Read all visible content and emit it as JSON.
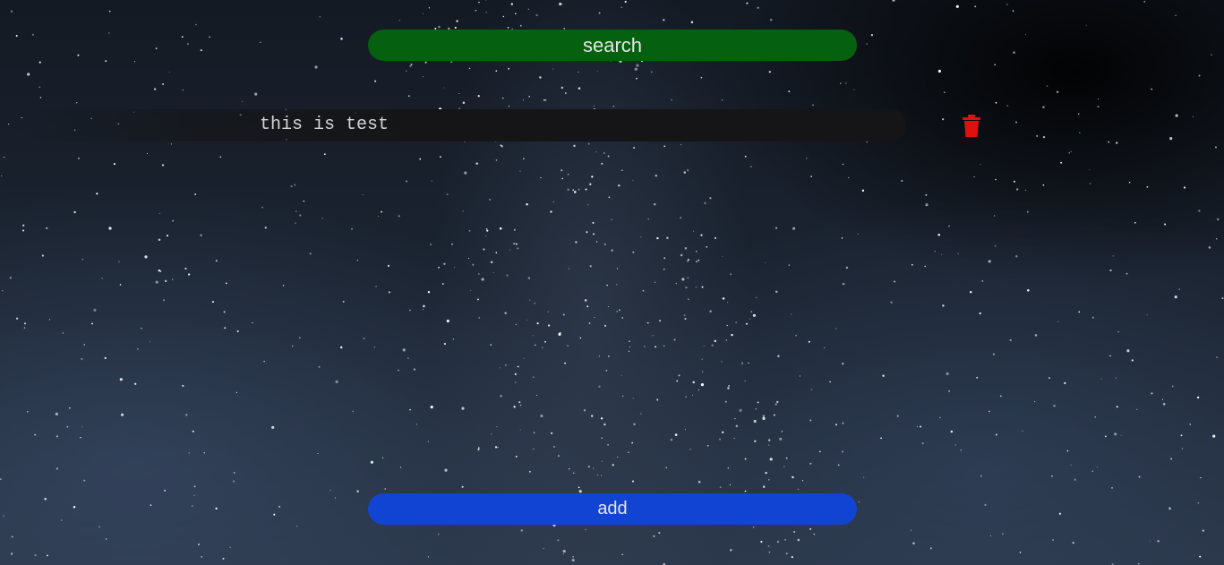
{
  "toolbar": {
    "search_label": "search"
  },
  "notes": [
    {
      "text": "this is test"
    }
  ],
  "footer": {
    "add_label": "add"
  },
  "icons": {
    "delete": "trash-icon"
  },
  "colors": {
    "search_button": "#05600f",
    "add_button": "#1244d4",
    "note_field": "#151517",
    "delete_icon": "#e0100d"
  }
}
